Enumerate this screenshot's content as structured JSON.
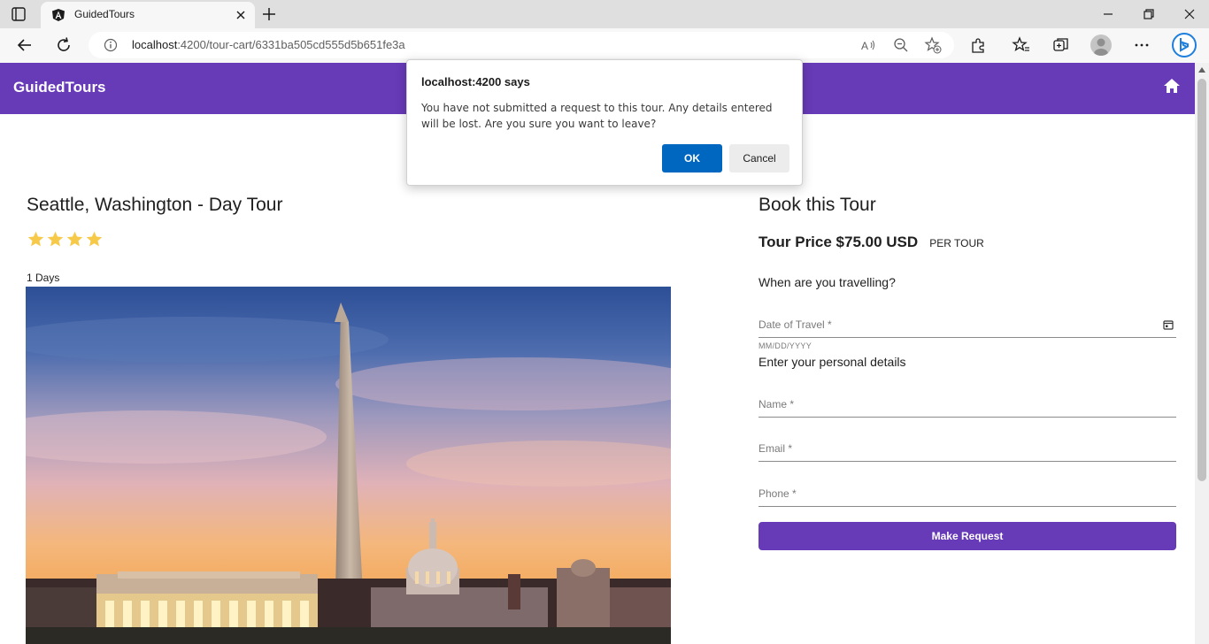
{
  "browser": {
    "tab_title": "GuidedTours",
    "url_host": "localhost",
    "url_path": ":4200/tour-cart/6331ba505cd555d5b651fe3a",
    "icons": [
      "tab-actions-icon",
      "angular-icon",
      "close-icon",
      "plus-icon",
      "minimize-icon",
      "restore-icon",
      "close-window-icon",
      "back-icon",
      "refresh-icon",
      "info-icon",
      "read-aloud-icon",
      "zoom-out-icon",
      "add-favorite-icon",
      "extensions-icon",
      "favorites-icon",
      "collections-icon",
      "avatar",
      "more-icon",
      "bing-icon"
    ]
  },
  "header": {
    "brand": "GuidedTours",
    "home_icon": "home-icon",
    "color": "#673ab7"
  },
  "tour": {
    "title": "Seattle, Washington - Day Tour",
    "rating": 4,
    "duration": "1 Days"
  },
  "booking": {
    "heading": "Book this Tour",
    "price": "Tour Price $75.00 USD",
    "per": "PER TOUR",
    "when_label": "When are you travelling?",
    "date_label": "Date of Travel *",
    "date_hint": "MM/DD/YYYY",
    "personal_label": "Enter your personal details",
    "name_label": "Name *",
    "email_label": "Email *",
    "phone_label": "Phone *",
    "submit": "Make Request"
  },
  "dialog": {
    "title": "localhost:4200 says",
    "message": "You have not submitted a request to this tour. Any details entered will be lost. Are you sure you want to leave?",
    "ok": "OK",
    "cancel": "Cancel",
    "ok_color": "#0067c0"
  }
}
